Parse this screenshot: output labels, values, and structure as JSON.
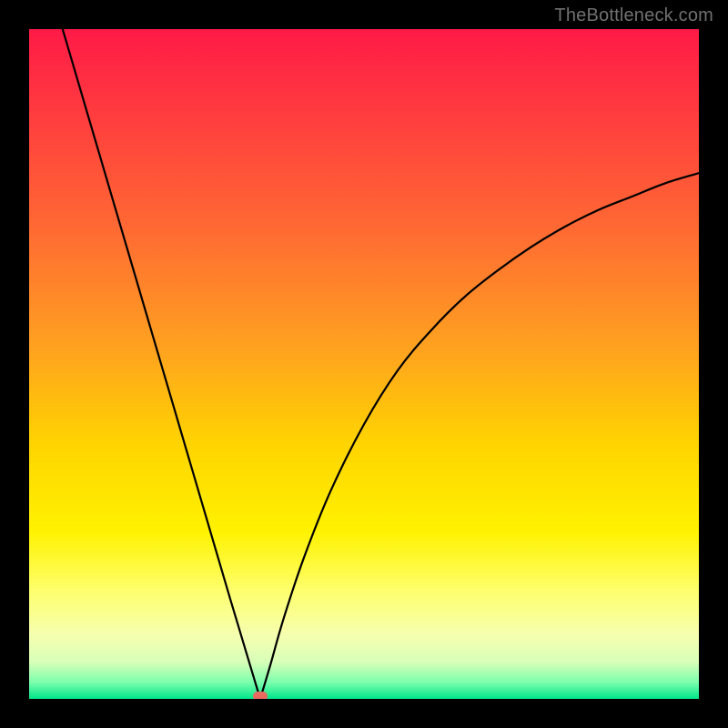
{
  "watermark": "TheBottleneck.com",
  "colors": {
    "frame": "#000000",
    "curve": "#000000",
    "minpoint": "#e96a5f",
    "gradient_stops": [
      {
        "offset": 0.0,
        "color": "#ff1a47"
      },
      {
        "offset": 0.12,
        "color": "#ff3a3f"
      },
      {
        "offset": 0.3,
        "color": "#ff6a33"
      },
      {
        "offset": 0.48,
        "color": "#ffa31f"
      },
      {
        "offset": 0.62,
        "color": "#ffd400"
      },
      {
        "offset": 0.75,
        "color": "#fff200"
      },
      {
        "offset": 0.84,
        "color": "#fdff6e"
      },
      {
        "offset": 0.905,
        "color": "#f6ffb0"
      },
      {
        "offset": 0.945,
        "color": "#d8ffb8"
      },
      {
        "offset": 0.975,
        "color": "#7dffad"
      },
      {
        "offset": 1.0,
        "color": "#00e58a"
      }
    ]
  },
  "chart_data": {
    "type": "line",
    "title": "",
    "xlabel": "",
    "ylabel": "",
    "xlim": [
      0,
      100
    ],
    "ylim": [
      0,
      100
    ],
    "minimum": {
      "x": 34.5,
      "y": 0
    },
    "left_branch": [
      {
        "x": 5,
        "y": 100
      },
      {
        "x": 10,
        "y": 83
      },
      {
        "x": 15,
        "y": 66
      },
      {
        "x": 20,
        "y": 49
      },
      {
        "x": 25,
        "y": 32
      },
      {
        "x": 30,
        "y": 15
      },
      {
        "x": 33,
        "y": 5
      },
      {
        "x": 34.5,
        "y": 0
      }
    ],
    "right_branch": [
      {
        "x": 34.5,
        "y": 0
      },
      {
        "x": 36,
        "y": 5
      },
      {
        "x": 38,
        "y": 12
      },
      {
        "x": 41,
        "y": 21
      },
      {
        "x": 45,
        "y": 31
      },
      {
        "x": 50,
        "y": 41
      },
      {
        "x": 55,
        "y": 49
      },
      {
        "x": 60,
        "y": 55
      },
      {
        "x": 65,
        "y": 60
      },
      {
        "x": 70,
        "y": 64
      },
      {
        "x": 75,
        "y": 67.5
      },
      {
        "x": 80,
        "y": 70.5
      },
      {
        "x": 85,
        "y": 73
      },
      {
        "x": 90,
        "y": 75
      },
      {
        "x": 95,
        "y": 77
      },
      {
        "x": 100,
        "y": 78.5
      }
    ]
  }
}
